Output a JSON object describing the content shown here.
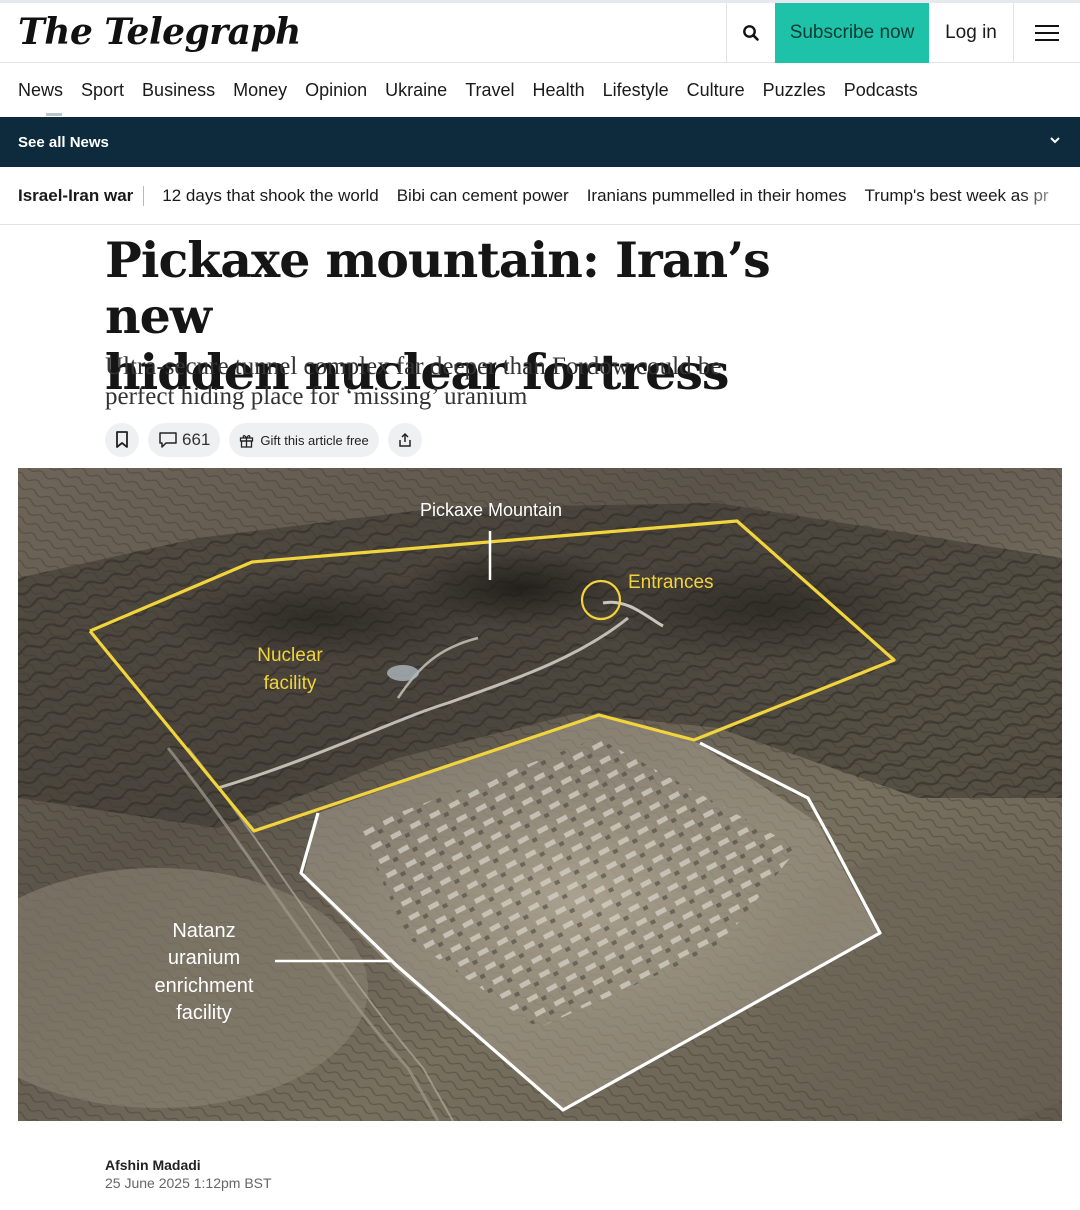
{
  "header": {
    "logo": "The Telegraph",
    "subscribe_label": "Subscribe now",
    "login_label": "Log in",
    "colors": {
      "subscribe_bg": "#1dc2a8",
      "nav_dark": "#0d2b3c"
    }
  },
  "nav": {
    "items": [
      "News",
      "Sport",
      "Business",
      "Money",
      "Opinion",
      "Ukraine",
      "Travel",
      "Health",
      "Lifestyle",
      "Culture",
      "Puzzles",
      "Podcasts"
    ]
  },
  "see_all": {
    "label": "See all News"
  },
  "topics": {
    "main": "Israel-Iran war",
    "links": [
      "12 days that shook the world",
      "Bibi can cement power",
      "Iranians pummelled in their homes",
      "Trump's best week as pr"
    ]
  },
  "article": {
    "headline_line1": "Pickaxe mountain: Iran’s new",
    "headline_line2": "hidden nuclear fortress",
    "standfirst_line1": "Ultra-secure tunnel complex far deeper than Fordow could be",
    "standfirst_line2": "perfect hiding place for ‘missing’ uranium",
    "comment_count": "661",
    "gift_label": "Gift this article free"
  },
  "figure": {
    "labels": {
      "pickaxe": "Pickaxe Mountain",
      "entrances": "Entrances",
      "nuclear_line1": "Nuclear",
      "nuclear_line2": "facility",
      "natanz_line1": "Natanz",
      "natanz_line2": "uranium",
      "natanz_line3": "enrichment",
      "natanz_line4": "facility"
    },
    "colors": {
      "yellow_outline": "#f2d43c",
      "white_outline": "#ffffff"
    }
  },
  "byline": {
    "author": "Afshin Madadi",
    "date": "25 June 2025 1:12pm BST"
  }
}
